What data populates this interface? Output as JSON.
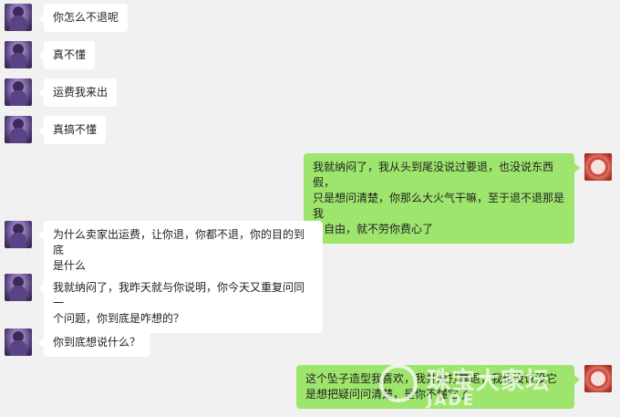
{
  "messages": [
    {
      "side": "left",
      "lines": [
        "你怎么不退呢"
      ]
    },
    {
      "side": "left",
      "lines": [
        "真不懂"
      ]
    },
    {
      "side": "left",
      "lines": [
        "运费我来出"
      ]
    },
    {
      "side": "left",
      "lines": [
        "真搞不懂"
      ]
    },
    {
      "side": "right",
      "lines": [
        "我就纳闷了，我从头到尾没说过要退，也没说东西假，",
        "只是想问清楚，你那么大火气干嘛，至于退不退那是我",
        "的自由，就不劳你费心了"
      ]
    },
    {
      "side": "left",
      "lines": [
        "为什么卖家出运费，让你退，你都不退，你的目的到底",
        "是什么"
      ]
    },
    {
      "side": "left",
      "lines": [
        "我就纳闷了，我昨天就与你说明，你今天又重复问同一",
        "个问题，你到底是咋想的？"
      ]
    },
    {
      "side": "left",
      "lines": [
        "你到底想说什么？"
      ]
    },
    {
      "side": "right",
      "lines": [
        "这个坠子造型我喜欢，我并没打算退，我也没说没它",
        "是想把疑问问清楚，是你不懂它了"
      ]
    }
  ],
  "watermark": {
    "brand_cn": "珠宝大家坛",
    "brand_en": "JADE"
  },
  "colors": {
    "background": "#f1f1f1",
    "bubble_left": "#ffffff",
    "bubble_right": "#9ee56d"
  }
}
